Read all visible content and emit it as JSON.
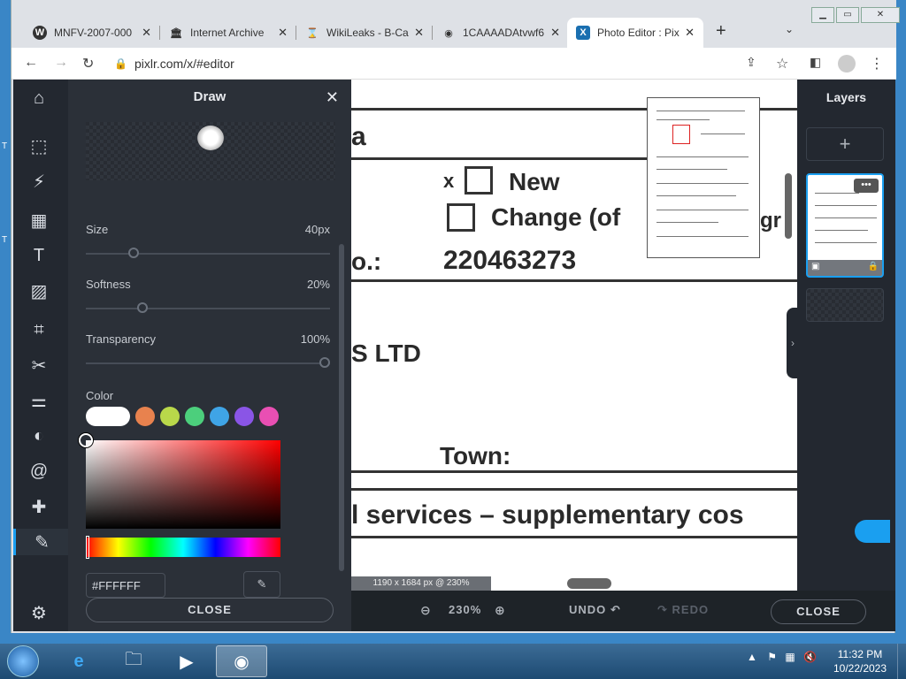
{
  "browser": {
    "tabs": [
      {
        "title": "MNFV-2007-000",
        "icon": "wordpress-icon",
        "icon_glyph": "W"
      },
      {
        "title": "Internet Archive",
        "icon": "archive-icon",
        "icon_glyph": "🏛"
      },
      {
        "title": "WikiLeaks - B-Ca",
        "icon": "wikileaks-icon",
        "icon_glyph": "⌛"
      },
      {
        "title": "1CAAAADAtvwf6",
        "icon": "globe-icon",
        "icon_glyph": "◉"
      },
      {
        "title": "Photo Editor : Pix",
        "icon": "pixlr-icon",
        "icon_glyph": "X"
      }
    ],
    "url": "pixlr.com/x/#editor"
  },
  "app": {
    "panel_title": "Draw",
    "size": {
      "label": "Size",
      "value": "40px",
      "level": 0.18
    },
    "softness": {
      "label": "Softness",
      "value": "20%",
      "level": 0.22
    },
    "transparency": {
      "label": "Transparency",
      "value": "100%",
      "level": 1.0
    },
    "color_label": "Color",
    "hex_value": "#FFFFFF",
    "close_label": "CLOSE",
    "swatches": [
      "#ffffff",
      "#e8824e",
      "#b9d84a",
      "#4ccf7c",
      "#3fa4e6",
      "#8a55e6",
      "#e94fb3"
    ]
  },
  "canvas": {
    "texts": [
      "a",
      "New",
      "Change (of",
      "gr",
      "o.:",
      "220463273",
      "S LTD",
      "Town:",
      "l services – supplementary cos"
    ],
    "checkbox_prefix": "x",
    "info": "1190 x 1684 px @ 230%"
  },
  "bottombar": {
    "zoom": "230%",
    "undo": "UNDO",
    "redo": "REDO",
    "close": "CLOSE"
  },
  "layers": {
    "title": "Layers",
    "add": "+",
    "menu": "•••"
  },
  "taskbar": {
    "time": "11:32 PM",
    "date": "10/22/2023"
  }
}
